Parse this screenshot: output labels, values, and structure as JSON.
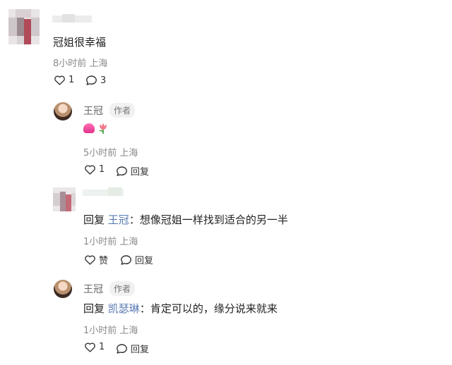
{
  "comment": {
    "text": "冠姐很幸福",
    "time": "8小时前",
    "location": "上海",
    "likes": "1",
    "replies": "3"
  },
  "reply1": {
    "author": "王冠",
    "badge": "作者",
    "emoji": [
      "pink-heart",
      "tulip"
    ],
    "time": "5小时前",
    "location": "上海",
    "likes": "1",
    "reply_label": "回复"
  },
  "reply2": {
    "prefix": "回复",
    "target": "王冠",
    "text": "：想像冠姐一样找到适合的另一半",
    "time": "1小时前",
    "location": "上海",
    "like_label": "赞",
    "reply_label": "回复"
  },
  "reply3": {
    "author": "王冠",
    "badge": "作者",
    "prefix": "回复",
    "target": "凯瑟琳",
    "text": "：肯定可以的，缘分说来就来",
    "time": "1小时前",
    "location": "上海",
    "likes": "1",
    "reply_label": "回复"
  },
  "colors": {
    "text": "#1f1f1f",
    "meta": "#8a8a8a",
    "link": "#5a7bb5",
    "badge_bg": "#f1f1f1"
  }
}
